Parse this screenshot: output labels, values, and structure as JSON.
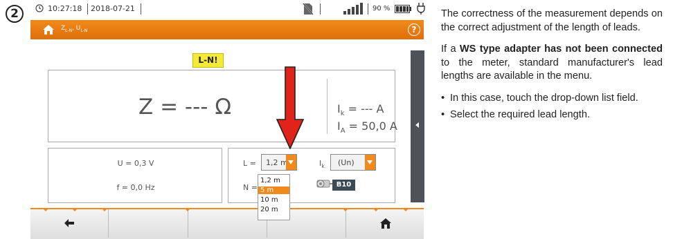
{
  "step": {
    "number": "2"
  },
  "status_bar": {
    "time": "10:27:18",
    "date": "2018-07-21",
    "battery_percent": "90 %"
  },
  "title_bar": {
    "title": "Z",
    "title_sub": "L-N",
    "title_mid": ", U",
    "title_sub2": "L-N",
    "help": "?"
  },
  "measurement": {
    "warning_badge": "L-N!",
    "z_value": "Z = --- Ω",
    "ik_label": "I",
    "ik_sub": "k",
    "ik_value": " = --- A",
    "ia_label": "I",
    "ia_sub": "A",
    "ia_value": " = 50,0 A"
  },
  "left_panel": {
    "u_value": "U = 0,3 V",
    "f_value": "f = 0,0 Hz"
  },
  "right_panel": {
    "l_label": "L =",
    "l_selected": "1,2 m",
    "n_label": "N =",
    "ik_label": "I",
    "ik_sub": "k",
    "ik_selected": "(Un)",
    "fuse_badge": "B10",
    "lead_options": [
      "1,2 m",
      "5 m",
      "10 m",
      "20 m"
    ],
    "highlighted_option": "5 m"
  },
  "help_text": {
    "p1": "The correctness of the measurement depends on the correct adjustment of the length of leads.",
    "p2_pre": "If a ",
    "p2_bold": "WS type adapter has not been connected",
    "p2_post": " to the meter, standard manufacturer's lead lengths are available in the menu.",
    "bullet1": "In this case, touch the drop-down list field.",
    "bullet2": "Select the required lead length."
  },
  "colors": {
    "accent": "#f08a1c",
    "arrow": "#e2231a",
    "warning": "#f5ea3a",
    "side_tab": "#4d5358"
  },
  "icons": [
    "clock-icon",
    "no-sim-icon",
    "signal-icon",
    "battery-icon",
    "plug-icon",
    "home-icon",
    "help-icon",
    "back-arrow-icon",
    "collapse-arrow-icon",
    "adapter-icon"
  ]
}
